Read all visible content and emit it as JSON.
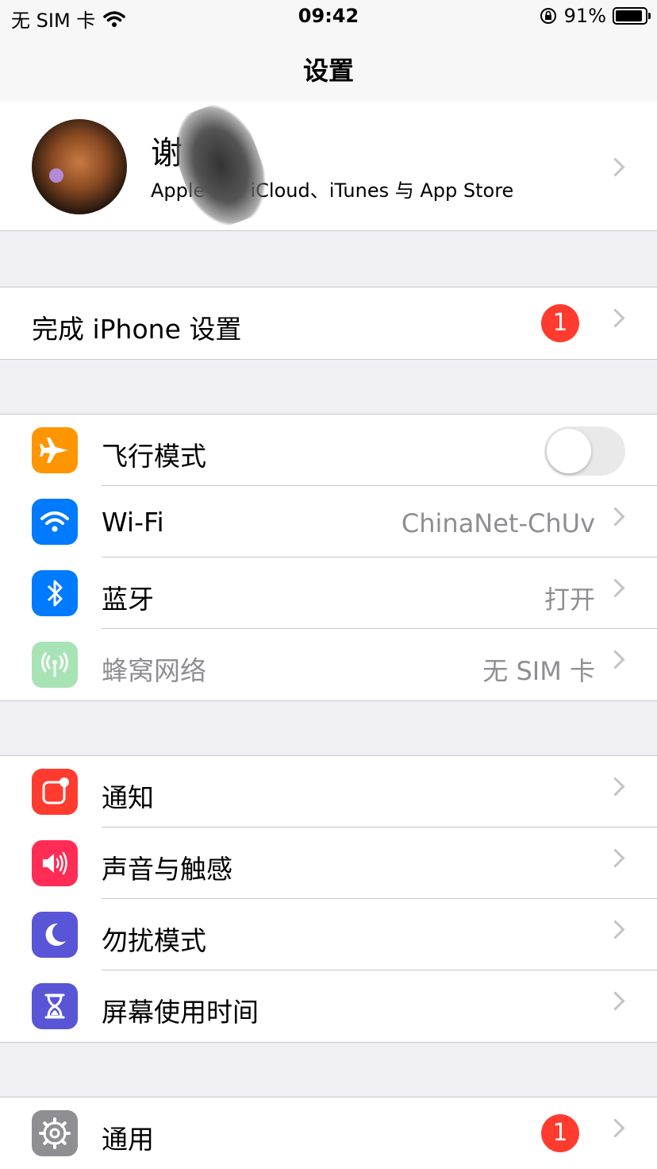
{
  "status_bar": {
    "carrier": "无 SIM 卡",
    "time": "09:42",
    "battery": "91%"
  },
  "nav": {
    "title": "设置"
  },
  "profile": {
    "name": "谢",
    "subtitle": "Apple ID、iCloud、iTunes 与 App Store"
  },
  "setup": {
    "label": "完成 iPhone 设置",
    "badge": "1"
  },
  "connectivity": [
    {
      "label": "飞行模式",
      "icon": "airplane-icon",
      "color": "#ff9500",
      "toggle": false
    },
    {
      "label": "Wi-Fi",
      "value": "ChinaNet-ChUv",
      "icon": "wifi-icon",
      "color": "#007aff"
    },
    {
      "label": "蓝牙",
      "value": "打开",
      "icon": "bluetooth-icon",
      "color": "#007aff"
    },
    {
      "label": "蜂窝网络",
      "value": "无 SIM 卡",
      "icon": "antenna-icon",
      "color": "#a8e3b5",
      "disabled": true
    }
  ],
  "alerts": [
    {
      "label": "通知",
      "icon": "notifications-icon",
      "color": "#ff3b30"
    },
    {
      "label": "声音与触感",
      "icon": "speaker-icon",
      "color": "#ff2d55"
    },
    {
      "label": "勿扰模式",
      "icon": "moon-icon",
      "color": "#5856d6"
    },
    {
      "label": "屏幕使用时间",
      "icon": "hourglass-icon",
      "color": "#5856d6"
    }
  ],
  "general": {
    "label": "通用",
    "badge": "1",
    "icon": "gear-icon",
    "color": "#8e8e93"
  }
}
